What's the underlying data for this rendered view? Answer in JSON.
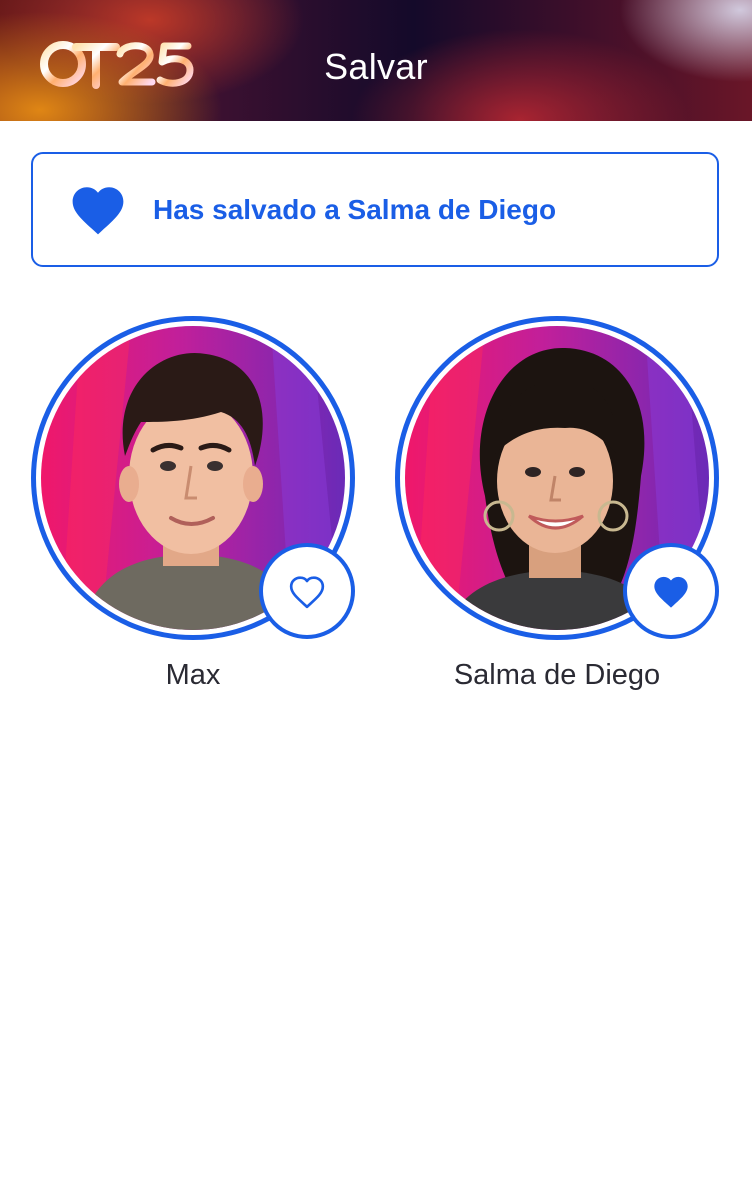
{
  "header": {
    "logo_text": "OT25",
    "title": "Salvar"
  },
  "banner": {
    "message": "Has salvado a Salma de Diego",
    "icon": "heart-filled-icon"
  },
  "candidates": [
    {
      "name": "Max",
      "saved": false,
      "save_icon": "heart-outline-icon"
    },
    {
      "name": "Salma de Diego",
      "saved": true,
      "save_icon": "heart-filled-icon"
    }
  ],
  "colors": {
    "accent": "#1a5ee6",
    "text": "#2a2a33",
    "header_text": "#ffffff"
  }
}
